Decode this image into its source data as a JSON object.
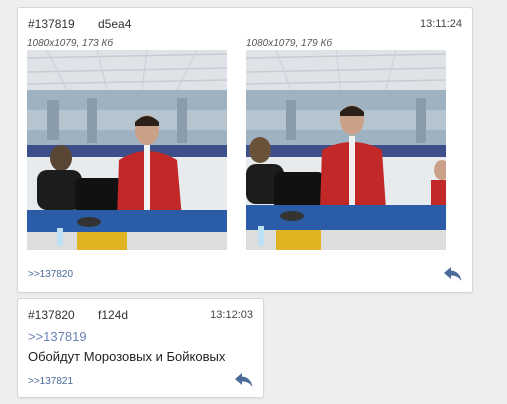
{
  "posts": [
    {
      "number": "#137819",
      "poster_id": "d5ea4",
      "time": "13:11:24",
      "files": [
        {
          "info": "1080x1079, 173 Кб"
        },
        {
          "info": "1080x1079, 179 Кб"
        }
      ],
      "backlink": ">>137820"
    },
    {
      "number": "#137820",
      "poster_id": "f124d",
      "time": "13:12:03",
      "quote_link": ">>137819",
      "text": "Обойдут Морозовых и Бойковых",
      "backlink": ">>137821"
    }
  ],
  "colors": {
    "link": "#4a6a9a",
    "quote": "#6b83b5",
    "reply_icon": "#4a6a9a"
  },
  "icons": {
    "reply": "reply-arrow-icon"
  }
}
